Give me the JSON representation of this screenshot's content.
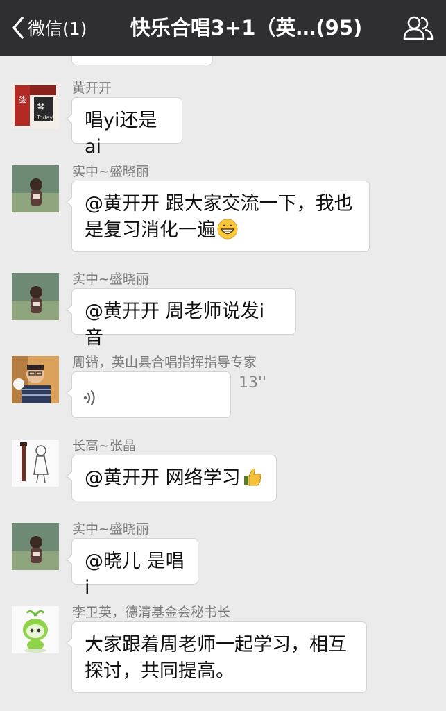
{
  "navbar": {
    "back_label": "微信(1)",
    "title": "快乐合唱3+1（英…(95)"
  },
  "messages": [
    {
      "sender": "黄开开",
      "text": "唱yi还是ai"
    },
    {
      "sender": "实中~盛晓丽",
      "line1": "@黄开开 跟大家交流一下，我也",
      "line2": "是复习消化一遍"
    },
    {
      "sender": "实中~盛晓丽",
      "text": "@黄开开 周老师说发i音"
    },
    {
      "sender": "周锴，英山县合唱指挥指导专家",
      "voice_duration": "13''"
    },
    {
      "sender": "长高~张晶",
      "text": "@黄开开 网络学习"
    },
    {
      "sender": "实中~盛晓丽",
      "text": "@晓儿 是唱i"
    },
    {
      "sender": "李卫英，德清基金会秘书长",
      "line1": "大家跟着周老师一起学习，相互",
      "line2": "探讨，共同提高。"
    }
  ],
  "icons": {
    "back": "chevron-left-icon",
    "group": "people-icon",
    "voice": "voice-wave-icon",
    "grin": "grinning-emoji",
    "thumbs": "thumbs-up-emoji"
  },
  "colors": {
    "navbar": "#2f2f31",
    "background": "#ebebeb",
    "bubble": "#ffffff"
  }
}
